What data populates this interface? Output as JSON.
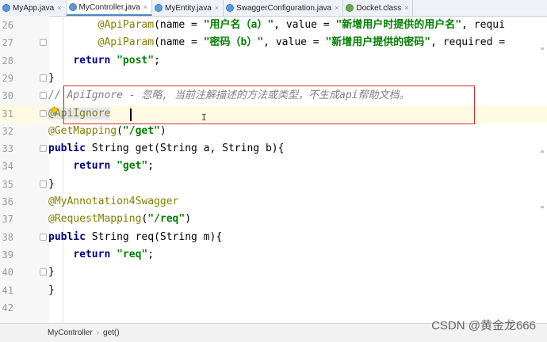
{
  "tabs": [
    {
      "label": "MyApp.java",
      "type": "java",
      "active": false
    },
    {
      "label": "MyController.java",
      "type": "java",
      "active": true
    },
    {
      "label": "MyEntity.java",
      "type": "java",
      "active": false
    },
    {
      "label": "SwaggerConfiguration.java",
      "type": "java",
      "active": false
    },
    {
      "label": "Docket.class",
      "type": "class",
      "active": false
    }
  ],
  "editor": {
    "lines": [
      {
        "n": "26",
        "indent": "        ",
        "tokens": [
          [
            "ann",
            "@ApiParam"
          ],
          [
            "",
            "(name = "
          ],
          [
            "str",
            "\"用户名（a）\""
          ],
          [
            "",
            ", value = "
          ],
          [
            "str",
            "\"新增用户时提供的用户名\""
          ],
          [
            "",
            ", requi"
          ]
        ]
      },
      {
        "n": "27",
        "indent": "        ",
        "tokens": [
          [
            "ann",
            "@ApiParam"
          ],
          [
            "",
            "(name = "
          ],
          [
            "str",
            "\"密码（b）\""
          ],
          [
            "",
            ", value = "
          ],
          [
            "str",
            "\"新增用户提供的密码\""
          ],
          [
            "",
            ", required = "
          ]
        ]
      },
      {
        "n": "28",
        "indent": "    ",
        "tokens": [
          [
            "kw",
            "return "
          ],
          [
            "str",
            "\"post\""
          ],
          [
            "",
            ";"
          ]
        ]
      },
      {
        "n": "29",
        "indent": "",
        "tokens": [
          [
            "",
            "}"
          ]
        ]
      },
      {
        "n": "30",
        "indent": "",
        "tokens": [
          [
            "cmt",
            "// ApiIgnore - 忽略, 当前注解描述的方法或类型，不生成api帮助文档。"
          ]
        ]
      },
      {
        "n": "31",
        "indent": "",
        "tokens": [
          [
            "ann hl",
            "@ApiIgnore"
          ]
        ]
      },
      {
        "n": "32",
        "indent": "",
        "tokens": [
          [
            "ann",
            "@GetMapping"
          ],
          [
            "",
            "("
          ],
          [
            "str",
            "\"/get\""
          ],
          [
            "",
            ")"
          ]
        ]
      },
      {
        "n": "33",
        "indent": "",
        "tokens": [
          [
            "kw",
            "public "
          ],
          [
            "",
            "String get(String a, String b){"
          ]
        ]
      },
      {
        "n": "34",
        "indent": "    ",
        "tokens": [
          [
            "kw",
            "return "
          ],
          [
            "str",
            "\"get\""
          ],
          [
            "",
            ";"
          ]
        ]
      },
      {
        "n": "35",
        "indent": "",
        "tokens": [
          [
            "",
            "}"
          ]
        ]
      },
      {
        "n": "36",
        "indent": "",
        "tokens": [
          [
            "ann",
            "@MyAnnotation4Swagger"
          ]
        ]
      },
      {
        "n": "37",
        "indent": "",
        "tokens": [
          [
            "ann",
            "@RequestMapping"
          ],
          [
            "",
            "("
          ],
          [
            "str",
            "\"/req\""
          ],
          [
            "",
            ")"
          ]
        ]
      },
      {
        "n": "38",
        "indent": "",
        "tokens": [
          [
            "kw",
            "public "
          ],
          [
            "",
            "String req(String m){"
          ]
        ]
      },
      {
        "n": "39",
        "indent": "    ",
        "tokens": [
          [
            "kw",
            "return "
          ],
          [
            "str",
            "\"req\""
          ],
          [
            "",
            ";"
          ]
        ]
      },
      {
        "n": "40",
        "indent": "",
        "tokens": [
          [
            "",
            "}"
          ]
        ]
      },
      {
        "n": "41",
        "indent": "",
        "tokens": [
          [
            "",
            "}"
          ]
        ]
      },
      {
        "n": "42",
        "indent": "",
        "tokens": []
      }
    ]
  },
  "breadcrumb": {
    "class_name": "MyController",
    "method_name": "get()"
  },
  "watermark": "CSDN @黄金龙666",
  "colors": {
    "annotation": "#808000",
    "keyword": "#000080",
    "string": "#008000",
    "comment": "#808080",
    "highlight_box": "#d42a2a"
  }
}
